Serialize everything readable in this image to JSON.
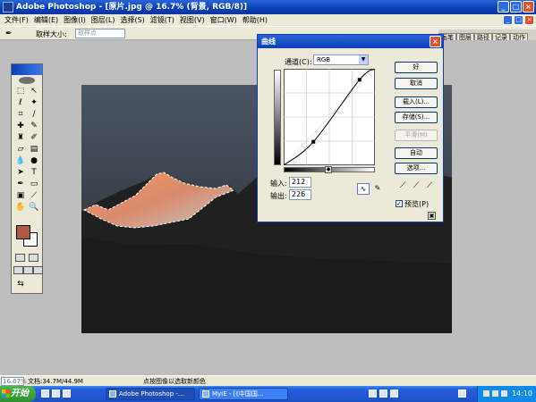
{
  "window": {
    "title": "Adobe Photoshop - [原片.jpg @ 16.7% (背景, RGB/8)]",
    "controls": [
      "_",
      "□",
      "×"
    ],
    "doc_controls": [
      "_",
      "□",
      "×"
    ]
  },
  "menubar": {
    "items": [
      "文件(F)",
      "编辑(E)",
      "图像(I)",
      "图层(L)",
      "选择(S)",
      "滤镜(T)",
      "视图(V)",
      "窗口(W)",
      "帮助(H)"
    ]
  },
  "options": {
    "tool_icon": "✒",
    "sample_label": "取样大小:",
    "sample_value": "取样点"
  },
  "palette_well": {
    "tabs": [
      "画笔",
      "图层",
      "路径",
      "记录",
      "动作"
    ]
  },
  "curves": {
    "title": "曲线",
    "close": "×",
    "channel_label": "通道(C):",
    "channel_value": "RGB",
    "input_label": "输入:",
    "input_value": "212",
    "output_label": "输出:",
    "output_value": "226",
    "buttons": {
      "ok": "好",
      "cancel": "取消",
      "load": "载入(L)...",
      "save": "存储(S)...",
      "smooth": "平滑(M)",
      "auto": "自动",
      "options": "选项..."
    },
    "preview_label": "预览(P)",
    "preview_checked": true,
    "points": [
      [
        0,
        0
      ],
      [
        83,
        62
      ],
      [
        212,
        226
      ],
      [
        255,
        255
      ]
    ]
  },
  "status": {
    "zoom": "16.67%",
    "docsize": "文档:34.7M/44.9M",
    "hint": "点按图像以选取新颜色"
  },
  "taskbar": {
    "start_label": "开始",
    "items": [
      "Adobe Photoshop -...",
      "MyIE - [《中国国..."
    ],
    "clock": "14:10"
  },
  "colors": {
    "foreground": "#b05a43",
    "background": "#ffffff"
  }
}
